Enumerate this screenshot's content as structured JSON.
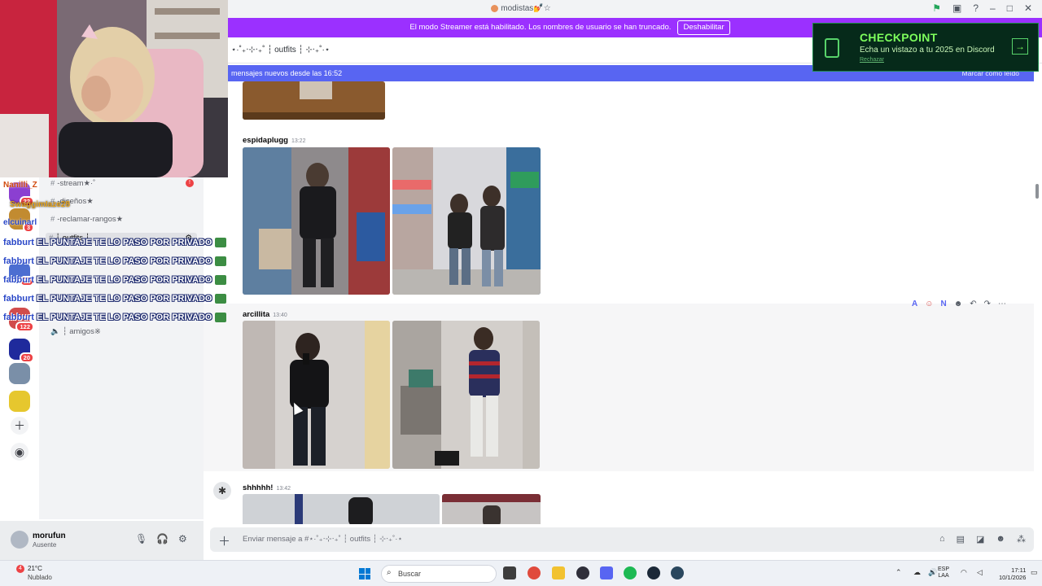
{
  "window": {
    "title": "modistas💅☆"
  },
  "banner": {
    "message": "El modo Streamer está habilitado. Los nombres de usuario se han truncado.",
    "button": "Deshabilitar"
  },
  "channel_header": {
    "name": "⋆·˚₊‧⊹‧₊˚ ┆ outfits ┆ ⊹‧₊˚·⋆"
  },
  "new_messages": {
    "label": "mensajes nuevos desde las 16:52",
    "mark_read": "Marcar como leído"
  },
  "promo": {
    "title": "CHECKPOINT",
    "subtitle": "Echa un vistazo a tu 2025 en Discord",
    "dismiss": "Rechazar"
  },
  "sidebar": {
    "channels": [
      {
        "name": "-stream★·˚"
      },
      {
        "name": "-diseños★"
      },
      {
        "name": "-reclamar-rangos★"
      },
      {
        "name": "┆ outfits ┆"
      },
      {
        "name": "┆ amigos※"
      }
    ],
    "badges": [
      "22",
      "3",
      "18",
      "122",
      "20"
    ]
  },
  "stream_chat": {
    "lines": [
      {
        "user": "fabburt",
        "text": "EL PUNTAJE TE LO PASO POR PRIVADO"
      },
      {
        "user": "fabburt",
        "text": "EL PUNTAJE TE LO PASO POR PRIVADO"
      },
      {
        "user": "fabburt",
        "text": "EL PUNTAJE TE LO PASO POR PRIVADO"
      },
      {
        "user": "fabburt",
        "text": "EL PUNTAJE TE LO PASO POR PRIVADO"
      },
      {
        "user": "fabburt",
        "text": "EL PUNTAJE TE LO PASO POR PRIVADO"
      }
    ],
    "names": [
      "Nanilli_Z",
      "SwaggimIaze28",
      "elcuinarl"
    ]
  },
  "messages": [
    {
      "author": "espidaplugg",
      "time": "13:22"
    },
    {
      "author": "arcillita",
      "time": "13:40"
    },
    {
      "author": "shhhhh!",
      "time": "13:42"
    }
  ],
  "user_panel": {
    "name": "morufun",
    "status": "Ausente"
  },
  "composer": {
    "placeholder": "Enviar mensaje a #⋆·˚₊‧⊹‧₊˚ ┆ outfits ┆ ⊹‧₊˚·⋆"
  },
  "taskbar": {
    "weather_temp": "21°C",
    "weather_cond": "Nublado",
    "weather_alerts": "4",
    "search_placeholder": "Buscar",
    "lang": "ESP",
    "lang_region": "LAA",
    "time": "17:11",
    "date": "10/1/2026"
  },
  "colors": {
    "accent": "#5865f2",
    "streamer": "#9b30ff",
    "promo_green": "#7dff5c",
    "badge": "#ed4245"
  }
}
